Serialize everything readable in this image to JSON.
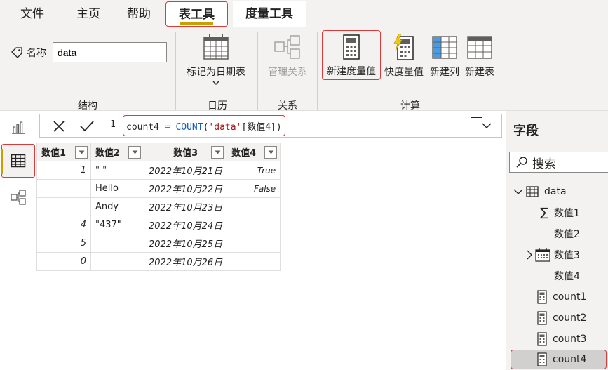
{
  "tabs": [
    "文件",
    "主页",
    "帮助",
    "表工具",
    "度量工具"
  ],
  "ribbon": {
    "name_label": "名称",
    "name_value": "data",
    "mark_date_table": "标记为日期表",
    "manage_relationships": "管理关系",
    "new_measure": "新建度量值",
    "quick_measure": "快度量值",
    "new_column": "新建列",
    "new_table": "新建表",
    "groups": {
      "structure": "结构",
      "calendar": "日历",
      "relationships": "关系",
      "calculations": "计算"
    }
  },
  "formula": {
    "line_number": "1",
    "part1": "count4 = ",
    "fn": "COUNT",
    "part2": "(",
    "str": "'data'",
    "part3": "[数值4])"
  },
  "table": {
    "headers": [
      "数值1",
      "数值2",
      "数值3",
      "数值4"
    ],
    "rows": [
      [
        "1",
        "\" \"",
        "2022年10月21日",
        "True"
      ],
      [
        "",
        "Hello",
        "2022年10月22日",
        "False"
      ],
      [
        "",
        "Andy",
        "2022年10月23日",
        ""
      ],
      [
        "4",
        "\"437\"",
        "2022年10月24日",
        ""
      ],
      [
        "5",
        "",
        "2022年10月25日",
        ""
      ],
      [
        "0",
        "",
        "2022年10月26日",
        ""
      ]
    ]
  },
  "fields": {
    "title": "字段",
    "search_placeholder": "搜索",
    "table_name": "data",
    "items": [
      "数值1",
      "数值2",
      "数值3",
      "数值4",
      "count1",
      "count2",
      "count3",
      "count4"
    ]
  },
  "colors": {
    "accent_red": "#d83b3b",
    "accent_gold": "#c8a100",
    "ribbon_bg": "#f3f2f1"
  }
}
